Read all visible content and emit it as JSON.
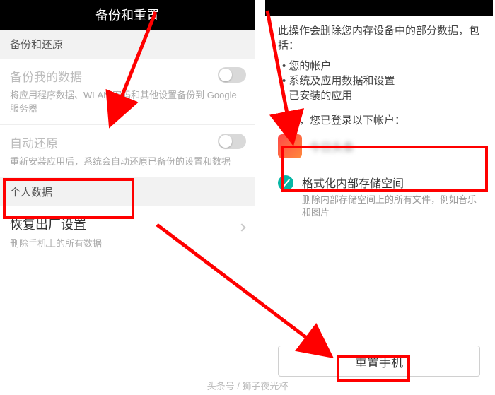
{
  "left": {
    "title": "备份和重置",
    "section_backup": "备份和还原",
    "backup_my_data": {
      "title": "备份我的数据",
      "sub": "将应用程序数据、WLAN 密码和其他设置备份到 Google 服务器"
    },
    "auto_restore": {
      "title": "自动还原",
      "sub": "重新安装应用后，系统会自动还原已备份的设置和数据"
    },
    "section_personal": "个人数据",
    "factory_reset": {
      "title": "恢复出厂设置",
      "sub": "删除手机上的所有数据"
    }
  },
  "right": {
    "warn": "此操作会删除您内存设备中的部分数据，包括：",
    "bullets": [
      "您的帐户",
      "系统及应用数据和设置",
      "已安装的应用"
    ],
    "logged_in": "目前，您已登录以下帐户：",
    "account_name": "今日头条",
    "option": {
      "title": "格式化内部存储空间",
      "sub": "删除内部存储空间上的所有文件，例如音乐和图片"
    },
    "button": "重置手机"
  },
  "watermark": "头条号 / 狮子夜光杯"
}
